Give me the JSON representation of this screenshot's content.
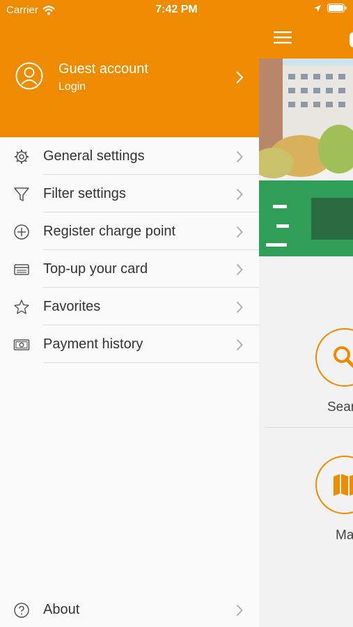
{
  "status_bar": {
    "carrier": "Carrier",
    "time": "7:42 PM"
  },
  "account": {
    "name": "Guest account",
    "action": "Login"
  },
  "menu": [
    {
      "label": "General settings",
      "icon": "gear-icon"
    },
    {
      "label": "Filter settings",
      "icon": "filter-icon"
    },
    {
      "label": "Register charge point",
      "icon": "plus-circle-icon"
    },
    {
      "label": "Top-up your card",
      "icon": "card-icon"
    },
    {
      "label": "Favorites",
      "icon": "star-icon"
    },
    {
      "label": "Payment history",
      "icon": "cash-icon"
    }
  ],
  "about": {
    "label": "About",
    "icon": "question-icon"
  },
  "main": {
    "search_label": "Sear",
    "map_label": "Ma"
  },
  "colors": {
    "accent": "#ef8b00"
  }
}
